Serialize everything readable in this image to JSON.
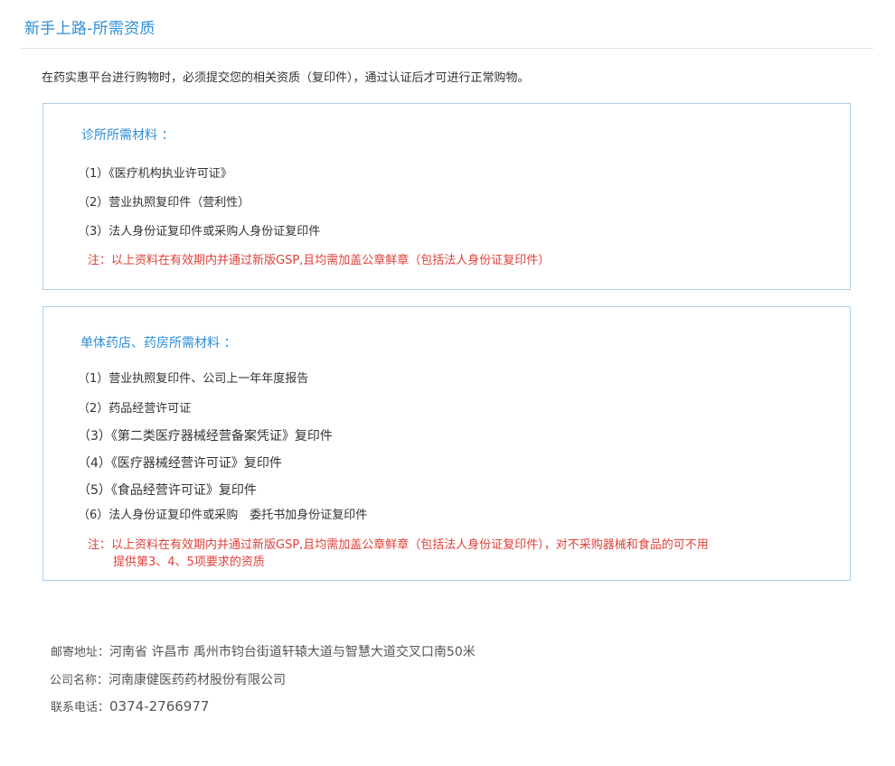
{
  "page": {
    "title": "新手上路-所需资质",
    "intro": "在药实惠平台进行购物时，必须提交您的相关资质（复印件），通过认证后才可进行正常购物。"
  },
  "clinic": {
    "title": "诊所所需材料 ：",
    "items": [
      "（1）《医疗机构执业许可证》",
      "（2）营业执照复印件（营利性）",
      "（3）法人身份证复印件或采购人身份证复印件"
    ],
    "note": "注：以上资料在有效期内并通过新版GSP,且均需加盖公章鲜章（包括法人身份证复印件）"
  },
  "pharmacy": {
    "title": "单体药店、药房所需材料 ：",
    "items": [
      "（1）营业执照复印件、公司上一年年度报告",
      "（2）药品经营许可证",
      "（3）《第二类医疗器械经营备案凭证》复印件",
      "（4）《医疗器械经营许可证》复印件",
      "（5）《食品经营许可证》复印件",
      "（6）法人身份证复印件或采购　委托书加身份证复印件"
    ],
    "note_line1": "注：以上资料在有效期内并通过新版GSP,且均需加盖公章鲜章（包括法人身份证复印件），对不采购器械和食品的可不用",
    "note_line2": "提供第3、4、5项要求的资质"
  },
  "contact": {
    "address_label": "邮寄地址：",
    "address": "河南省 许昌市 禹州市钧台街道轩辕大道与智慧大道交叉口南50米",
    "company_label": "公司名称：",
    "company": "河南康健医药药材股份有限公司",
    "phone_label": "联系电话：",
    "phone": "0374-2766977"
  },
  "colors": {
    "accent": "#2e8ed6",
    "note": "#e0413a",
    "border": "#a9cfe6"
  }
}
